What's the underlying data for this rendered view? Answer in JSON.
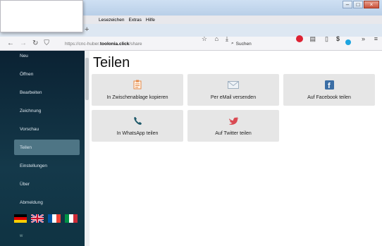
{
  "browser": {
    "menu": [
      "Lesezeichen",
      "Extras",
      "Hilfe"
    ],
    "url_prefix": "https://cnc-huber.",
    "url_domain": "toolonia.click",
    "url_path": "/share",
    "search_placeholder": "Suchen",
    "newtab": "+"
  },
  "sidebar": {
    "items": [
      {
        "label": "Neu"
      },
      {
        "label": "Öffnen"
      },
      {
        "label": "Bearbeiten"
      },
      {
        "label": "Zeichnung"
      },
      {
        "label": "Vorschau"
      },
      {
        "label": "Teilen"
      },
      {
        "label": "Einstellungen"
      },
      {
        "label": "Über"
      },
      {
        "label": "Abmeldung"
      }
    ],
    "active": "Teilen",
    "version": "w"
  },
  "page": {
    "title": "Teilen",
    "tiles": [
      {
        "label": "In Zwischenablage kopieren",
        "icon": "clipboard-icon"
      },
      {
        "label": "Per eMail versenden",
        "icon": "envelope-icon"
      },
      {
        "label": "Auf Facebook teilen",
        "icon": "facebook-icon"
      },
      {
        "label": "In WhatsApp teilen",
        "icon": "phone-icon"
      },
      {
        "label": "Auf Twitter teilen",
        "icon": "twitter-bird-icon"
      }
    ]
  },
  "colors": {
    "sidebar_top": "#0b2233",
    "sidebar_active": "#4e7585",
    "tile_bg": "#e6e6e6",
    "facebook": "#3b6ea5",
    "twitter": "#d94a52"
  }
}
